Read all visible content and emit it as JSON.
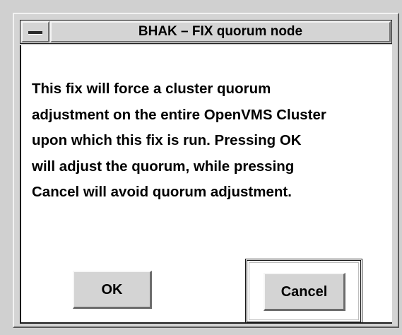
{
  "window": {
    "title": "BHAK – FIX quorum node",
    "system_menu_icon": "window-menu-icon"
  },
  "message": {
    "lines": [
      "This fix will force a cluster quorum",
      "adjustment on the entire OpenVMS Cluster",
      "upon which this fix is run. Pressing OK",
      "will adjust the quorum, while pressing",
      "Cancel will avoid quorum adjustment."
    ]
  },
  "buttons": {
    "ok_label": "OK",
    "cancel_label": "Cancel",
    "default_button": "cancel"
  },
  "colors": {
    "face": "#d4d4d4",
    "client_background": "#ffffff",
    "text": "#000000"
  }
}
